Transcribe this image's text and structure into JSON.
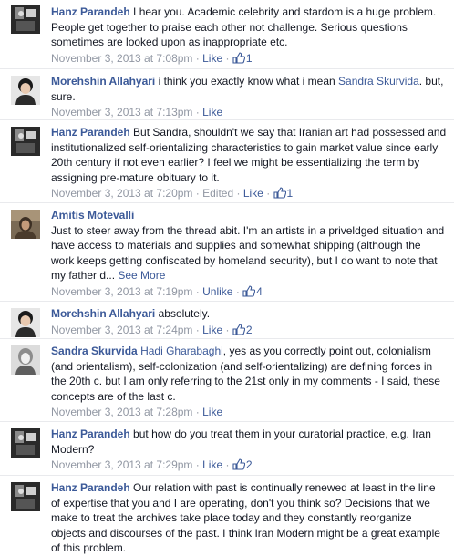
{
  "comments": [
    {
      "author": "Hanz Parandeh",
      "text": "I hear you. Academic celebrity and stardom is a huge problem. People get together to praise each other not challenge. Serious questions sometimes are looked upon as inappropriate etc.",
      "timestamp": "November 3, 2013 at 7:08pm",
      "action": "Like",
      "likes": "1",
      "avatar": "hanz-avatar"
    },
    {
      "author": "Morehshin Allahyari",
      "text": "i think you exactly know what i mean",
      "mention": "Sandra Skurvida",
      "text_after": ". but, sure.",
      "timestamp": "November 3, 2013 at 7:13pm",
      "action": "Like",
      "avatar": "morehshin-avatar"
    },
    {
      "author": "Hanz Parandeh",
      "text": "But Sandra, shouldn't we say that Iranian art had possessed and institutionalized self-orientalizing characteristics to gain market value since early 20th century if not even earlier? I feel we might be essentializing the term by assigning pre-mature obituary to it.",
      "timestamp": "November 3, 2013 at 7:20pm",
      "edited": "Edited",
      "action": "Like",
      "likes": "1",
      "avatar": "hanz-avatar"
    },
    {
      "author": "Amitis Motevalli",
      "text": "Just to steer away from the thread abit. I'm an artists in a priveldged situation and have access to materials and supplies and somewhat shipping (although the work keeps getting confiscated by homeland security), but I do want to note that my father d...",
      "see_more": "See More",
      "timestamp": "November 3, 2013 at 7:19pm",
      "action": "Unlike",
      "likes": "4",
      "avatar": "amitis-avatar"
    },
    {
      "author": "Morehshin Allahyari",
      "text": "absolutely.",
      "timestamp": "November 3, 2013 at 7:24pm",
      "action": "Like",
      "likes": "2",
      "avatar": "morehshin-avatar"
    },
    {
      "author": "Sandra Skurvida",
      "mention": "Hadi Gharabaghi",
      "text_after": ", yes as you correctly point out, colonialism (and orientalism), self-colonization (and self-orientalizing) are defining forces in the 20th c. but I am only referring to the 21st only in my comments - I said, these concepts are of the last c.",
      "timestamp": "November 3, 2013 at 7:28pm",
      "action": "Like",
      "avatar": "sandra-avatar"
    },
    {
      "author": "Hanz Parandeh",
      "text": "but how do you treat them in your curatorial practice, e.g. Iran Modern?",
      "timestamp": "November 3, 2013 at 7:29pm",
      "action": "Like",
      "likes": "2",
      "avatar": "hanz-avatar"
    },
    {
      "author": "Hanz Parandeh",
      "text": "Our relation with past is continually renewed at least in the line of expertise that you and I are operating, don't you think so? Decisions that we make to treat the archives take place today and they constantly reorganize objects and discourses of the past. I think Iran Modern might be a great example of this problem.",
      "avatar": "hanz-avatar"
    }
  ],
  "colors": {
    "link": "#3b5998",
    "meta": "#9197a3",
    "text": "#141823"
  },
  "icons": {
    "like_count": "thumbs-up-icon"
  }
}
